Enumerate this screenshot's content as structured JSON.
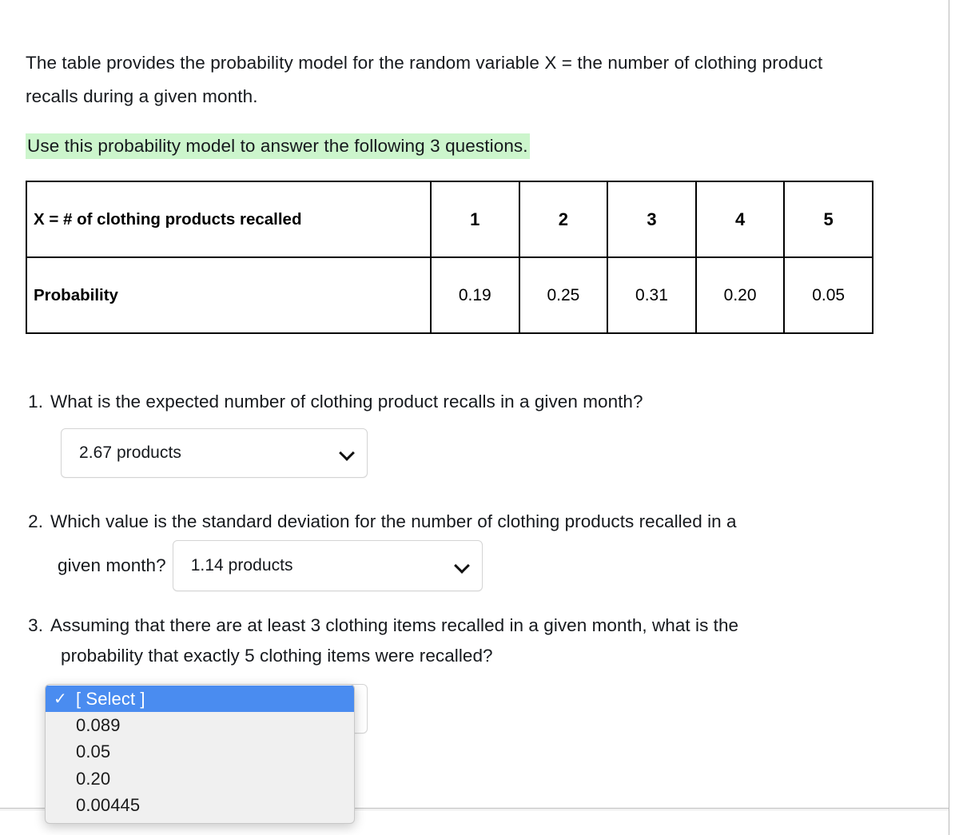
{
  "intro": {
    "paragraph": "The table provides the probability model for the random variable  X = the number of clothing product recalls during a given month.",
    "highlight": "Use this probability model to answer the following 3 questions."
  },
  "table": {
    "row_header_label": "X = # of clothing products recalled",
    "row_prob_label": "Probability",
    "x_values": [
      "1",
      "2",
      "3",
      "4",
      "5"
    ],
    "probabilities": [
      "0.19",
      "0.25",
      "0.31",
      "0.20",
      "0.05"
    ]
  },
  "questions": [
    {
      "number": "1.",
      "text": "What is the expected number of clothing product recalls in a given month?",
      "select_value": "2.67 products"
    },
    {
      "number": "2.",
      "text_line1": "Which value is the standard deviation for the number of clothing products recalled in a",
      "text_line2": "given month?",
      "select_value": "1.14 products"
    },
    {
      "number": "3.",
      "text_line1": "Assuming that there are at least 3 clothing items recalled in a given month, what is the",
      "text_line2": "probability that exactly 5 clothing items were recalled?",
      "select_value": ""
    }
  ],
  "dropdown": {
    "checkmark": "✓",
    "options": [
      {
        "label": "[ Select ]",
        "selected": true
      },
      {
        "label": "0.089",
        "selected": false
      },
      {
        "label": "0.05",
        "selected": false
      },
      {
        "label": "0.20",
        "selected": false
      },
      {
        "label": "0.00445",
        "selected": false
      }
    ]
  },
  "colors": {
    "highlight_green": "#ccf5cc",
    "dropdown_selected_blue": "#4a8cf0",
    "table_border": "#000000",
    "divider": "#b9b9b9"
  }
}
